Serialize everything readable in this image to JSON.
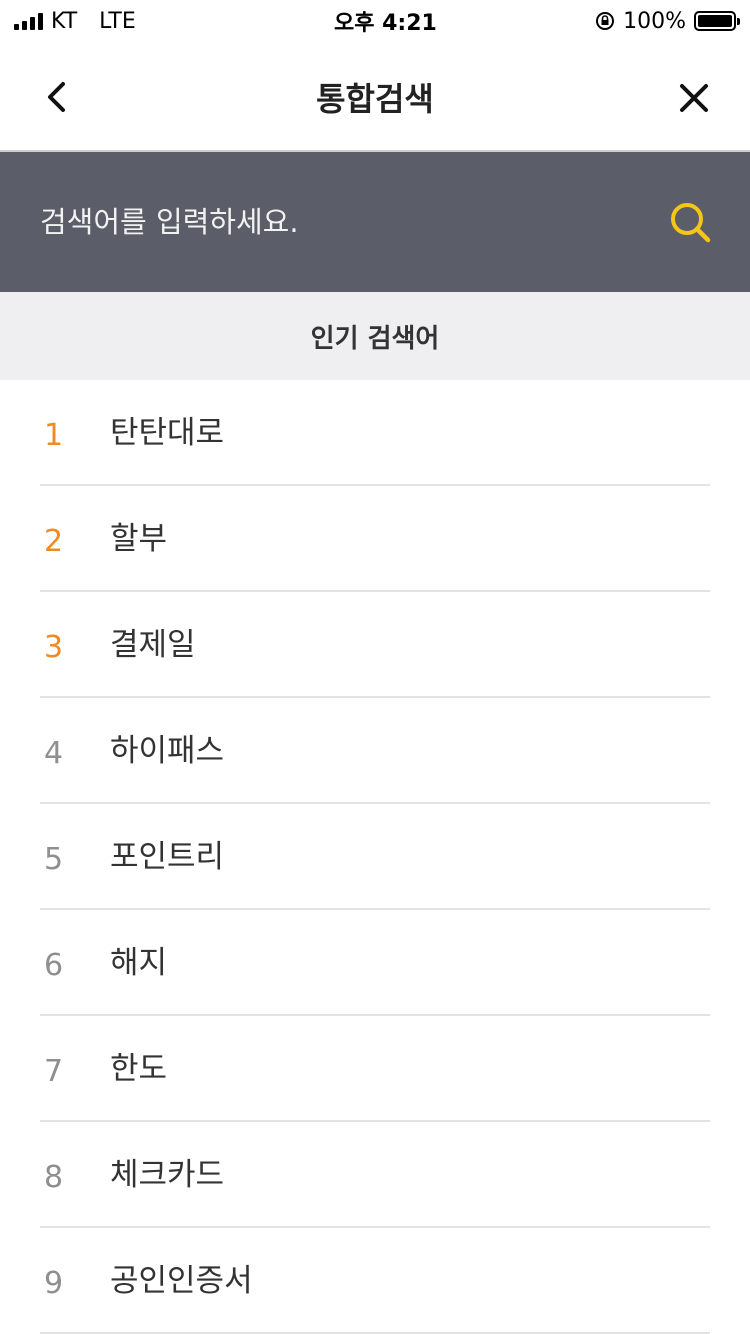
{
  "status_bar": {
    "carrier": "KT",
    "network": "LTE",
    "time": "오후 4:21",
    "battery_percent": "100%",
    "battery_level": 1.0
  },
  "header": {
    "title": "통합검색",
    "back_icon": "chevron-left-icon",
    "close_icon": "close-icon"
  },
  "search": {
    "placeholder": "검색어를 입력하세요.",
    "value": "",
    "icon": "search-icon",
    "icon_color": "#f5c518",
    "background_color": "#5b5e68"
  },
  "popular": {
    "heading": "인기 검색어",
    "top_rank_color": "#f08a24",
    "highlight_color": "#ffd84a",
    "items": [
      {
        "rank": "1",
        "term": "탄탄대로",
        "top": true
      },
      {
        "rank": "2",
        "term": "할부",
        "top": true
      },
      {
        "rank": "3",
        "term": "결제일",
        "top": true
      },
      {
        "rank": "4",
        "term": "하이패스",
        "top": false
      },
      {
        "rank": "5",
        "term": "포인트리",
        "top": false
      },
      {
        "rank": "6",
        "term": "해지",
        "top": false,
        "highlighted": true
      },
      {
        "rank": "7",
        "term": "한도",
        "top": false
      },
      {
        "rank": "8",
        "term": "체크카드",
        "top": false
      },
      {
        "rank": "9",
        "term": "공인인증서",
        "top": false
      }
    ]
  }
}
